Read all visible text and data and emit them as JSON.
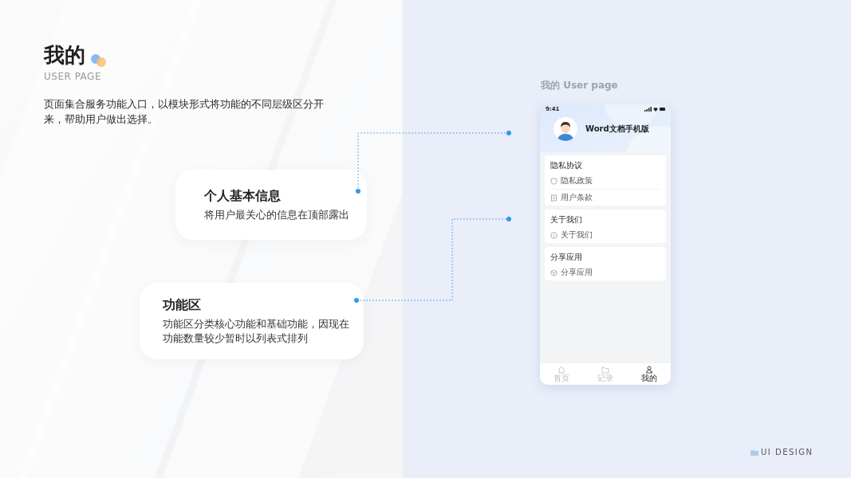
{
  "title": "我的",
  "subtitle": "USER PAGE",
  "description": "页面集合服务功能入口，以模块形式将功能的不同层级区分开来，帮助用户做出选择。",
  "callouts": [
    {
      "title": "个人基本信息",
      "text": "将用户最关心的信息在顶部露出"
    },
    {
      "title": "功能区",
      "text": "功能区分类核心功能和基础功能，因现在功能数量较少暂时以列表式排列"
    }
  ],
  "phone_caption": "我的 User page",
  "phone": {
    "status_time": "9:41",
    "user_name": "Word文档手机版",
    "sections": [
      {
        "title": "隐私协议",
        "items": [
          {
            "label": "隐私政策",
            "kind": "shield"
          },
          {
            "label": "用户条款",
            "kind": "document"
          }
        ]
      },
      {
        "title": "关于我们",
        "items": [
          {
            "label": "关于我们",
            "kind": "info"
          }
        ]
      },
      {
        "title": "分享应用",
        "items": [
          {
            "label": "分享应用",
            "kind": "cube"
          }
        ]
      }
    ],
    "tabs": [
      {
        "label": "首页",
        "kind": "home",
        "selected": false
      },
      {
        "label": "记录",
        "kind": "folder",
        "selected": false
      },
      {
        "label": "我的",
        "kind": "user",
        "selected": true
      }
    ]
  },
  "footer": "UI DESIGN"
}
